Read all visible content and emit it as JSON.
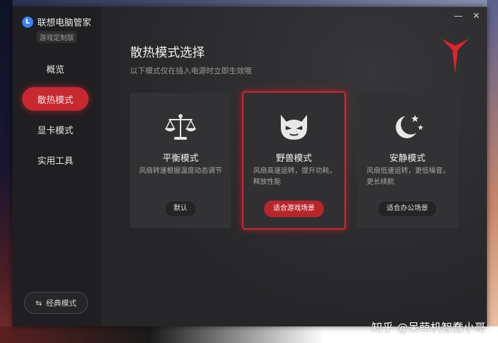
{
  "app": {
    "logo_letter": "L",
    "name": "联想电脑管家",
    "edition": "游戏定制版"
  },
  "sidebar": {
    "items": [
      {
        "label": "概览",
        "active": false
      },
      {
        "label": "散热模式",
        "active": true
      },
      {
        "label": "显卡模式",
        "active": false
      },
      {
        "label": "实用工具",
        "active": false
      }
    ],
    "classic_label": "经典模式",
    "classic_icon": "⇆"
  },
  "window_controls": {
    "minimize": "—",
    "close": "✕"
  },
  "main": {
    "title": "散热模式选择",
    "subtitle": "以下模式仅在插入电源时立即生效哦"
  },
  "cards": [
    {
      "name": "平衡模式",
      "desc": "风扇转速根据温度动态调节",
      "button": "默认",
      "icon": "balance-scale-icon"
    },
    {
      "name": "野兽模式",
      "desc": "风扇高速运转，提升功耗，释放性能",
      "button": "适合游戏场景",
      "icon": "beast-face-icon",
      "selected": true
    },
    {
      "name": "安静模式",
      "desc": "风扇低速运转，更低噪音，更长续航",
      "button": "适合办公场景",
      "icon": "moon-stars-icon"
    }
  ],
  "colors": {
    "accent": "#c8282f",
    "sidebar": "#1f1f21",
    "panel": "#323234"
  },
  "watermark": "知乎 @呆萌机智蠢小哥"
}
